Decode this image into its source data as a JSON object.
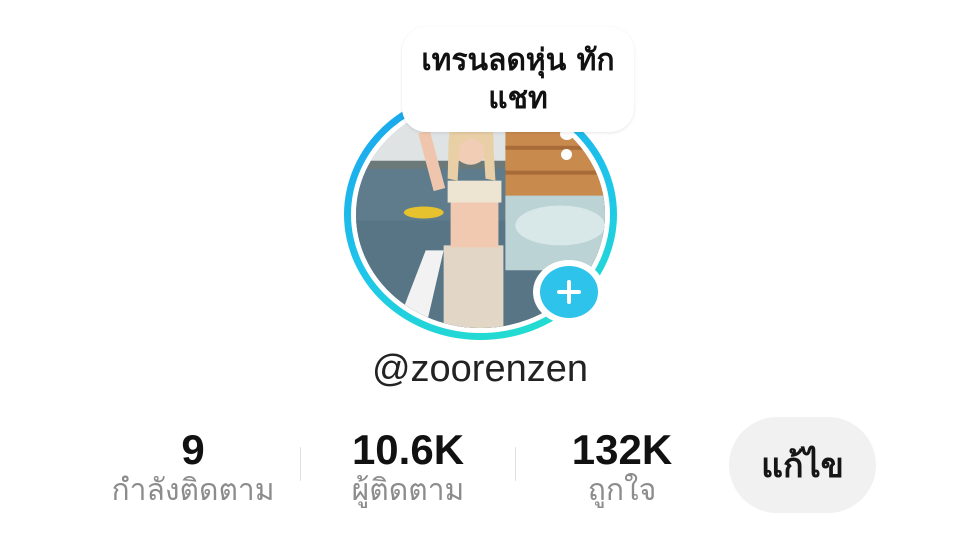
{
  "bubble": {
    "text": "เทรนลดหุ่น ทักแชท"
  },
  "profile": {
    "username": "@zoorenzen"
  },
  "stats": {
    "following": {
      "value": "9",
      "label": "กำลังติดตาม"
    },
    "followers": {
      "value": "10.6K",
      "label": "ผู้ติดตาม"
    },
    "likes": {
      "value": "132K",
      "label": "ถูกใจ"
    }
  },
  "actions": {
    "edit_label": "แก้ไข"
  },
  "colors": {
    "ring_start": "#1aa1ee",
    "ring_end": "#25e3c8",
    "add_badge": "#2ec3ea",
    "stat_label": "#8c8c8c",
    "edit_button_bg": "#f1f1f2"
  },
  "icons": {
    "add_badge": "plus-icon"
  }
}
